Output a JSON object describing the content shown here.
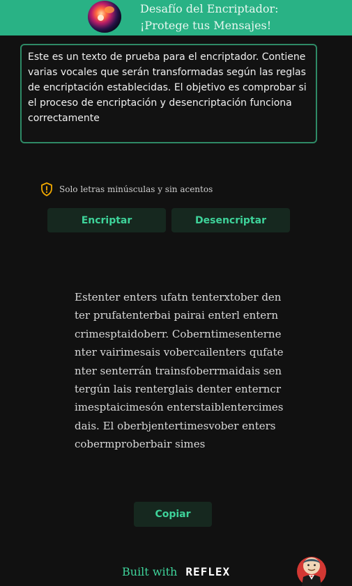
{
  "header": {
    "title_line1": "Desafío del Encriptador:",
    "title_line2": "¡Protege tus Mensajes!"
  },
  "input": {
    "value": "Este es un texto de prueba para el encriptador. Contiene varias vocales que serán transformadas según las reglas de encriptación establecidas. El objetivo es comprobar si el proceso de encriptación y desencriptación funciona correctamente"
  },
  "warning": {
    "icon": "warning-shield-icon",
    "text": "Solo letras minúsculas y sin acentos",
    "color": "#f2a900"
  },
  "actions": {
    "encrypt_label": "Encriptar",
    "decrypt_label": "Desencriptar",
    "copy_label": "Copiar"
  },
  "output": {
    "text": "Estenter enters ufatn tenterxtober denter prufatenterbai pairai enterl enterncrimesptaidoberr. Coberntimesenternenter vairimesais vobercailenters qufatenter senterrán trainsfoberrmaidais sentergún lais renterglais denter enterncrimesptaicimesón enterstaiblentercimesdais. El oberbjentertimesvober enters cobermproberbair simes"
  },
  "footer": {
    "built_with": "Built with",
    "brand": "REFLEX"
  },
  "colors": {
    "header_bg": "#29b285",
    "accent": "#3ed39a",
    "page_bg": "#111111"
  }
}
